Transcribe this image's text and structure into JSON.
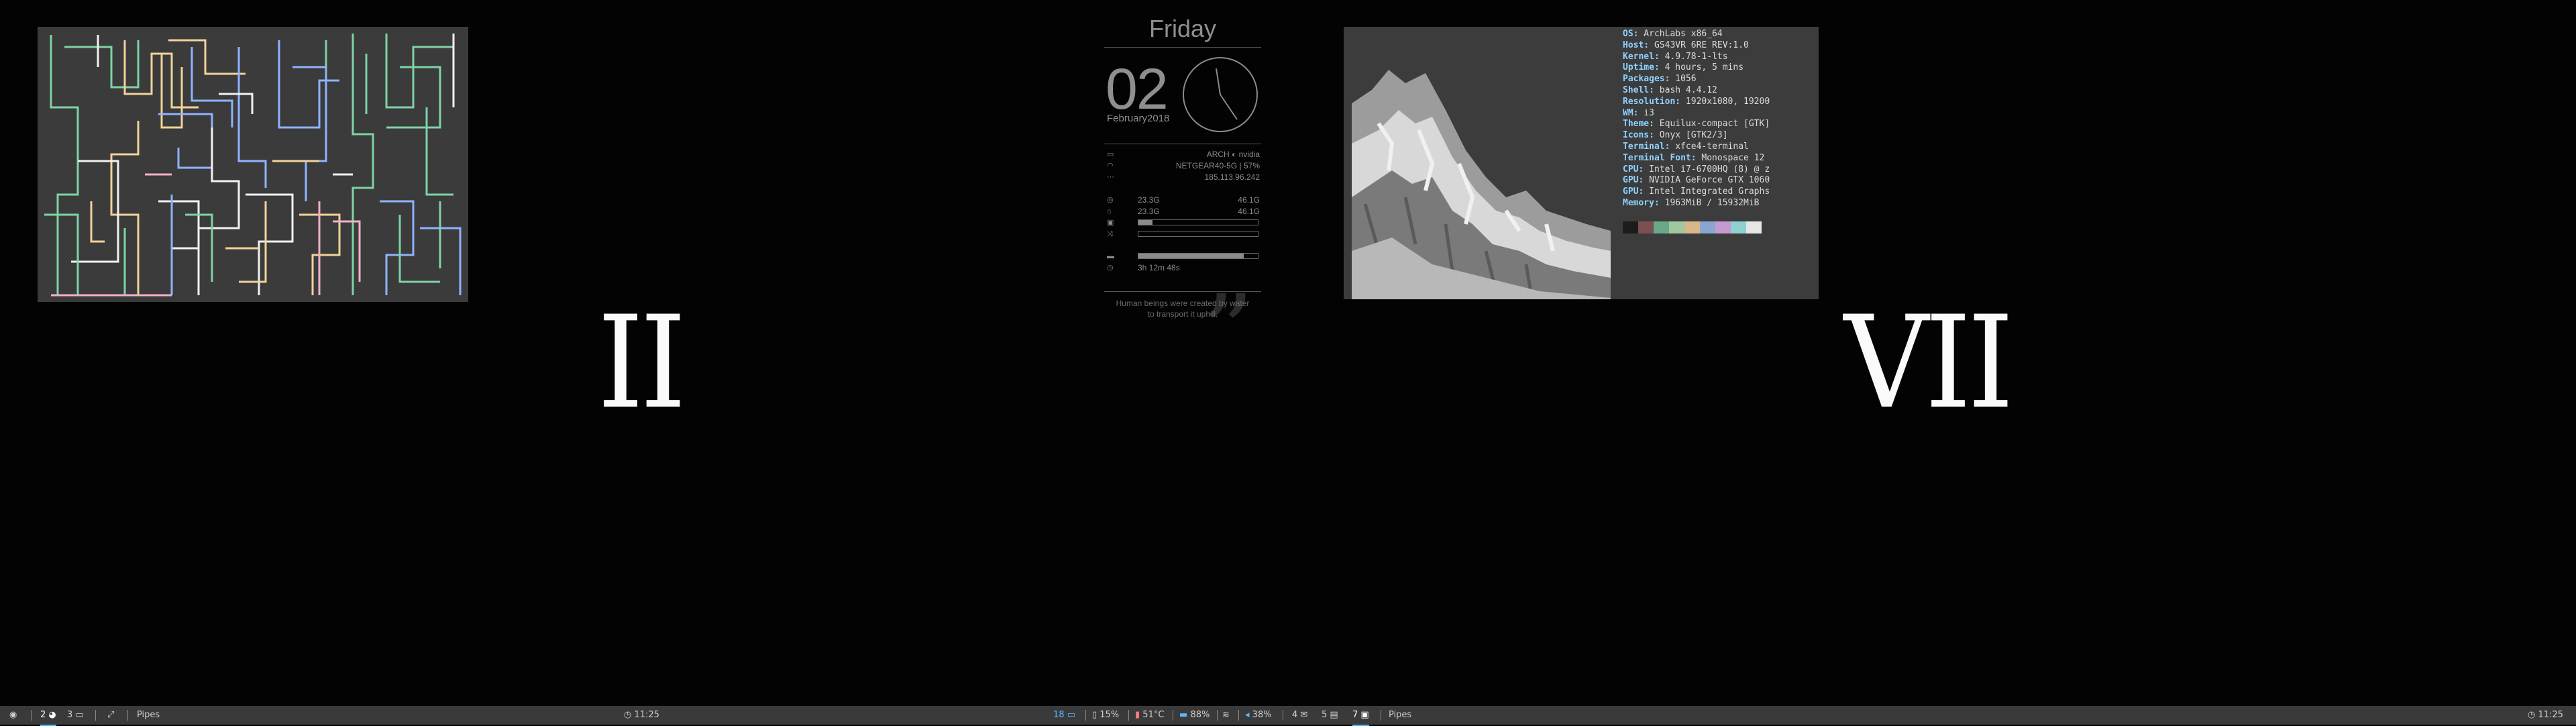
{
  "taskbar_left": {
    "workspaces": [
      {
        "label": "2",
        "icon": "globe-icon"
      },
      {
        "label": "3",
        "icon": "folder-icon"
      }
    ],
    "window_title": "Pipes",
    "clock": "11:25"
  },
  "taskbar_right": {
    "workspace_current": "18",
    "cpu": "15%",
    "temp": "51°C",
    "battery": "88%",
    "volume": "38%",
    "workspaces": [
      {
        "label": "4",
        "icon": "mail-icon"
      },
      {
        "label": "5",
        "icon": "document-icon"
      },
      {
        "label": "7",
        "icon": "terminal-icon"
      }
    ],
    "window_title": "Pipes",
    "clock": "11:25"
  },
  "workspaces": {
    "left_numeral": "II",
    "right_numeral": "VII"
  },
  "conky": {
    "day": "Friday",
    "date": "02",
    "month": "February2018",
    "distro": "ARCH",
    "gpu": "nvidia",
    "network": "NETGEAR40-5G | 57%",
    "ip": "185.113.96.242",
    "disk1_used": "23.3G",
    "disk1_total": "46.1G",
    "disk2_used": "23.3G",
    "disk2_total": "46.1G",
    "uptime": "3h 12m 48s",
    "quote": "Human beings were created by water\nto transport it uphill.",
    "bars": {
      "cpu": 0.12,
      "mem": 0.0,
      "battery": 0.88
    }
  },
  "neofetch": {
    "lines": [
      {
        "key": "OS",
        "value": " ArchLabs x86_64"
      },
      {
        "key": "Host",
        "value": " GS43VR 6RE REV:1.0"
      },
      {
        "key": "Kernel",
        "value": " 4.9.78-1-lts"
      },
      {
        "key": "Uptime",
        "value": " 4 hours, 5 mins"
      },
      {
        "key": "Packages",
        "value": " 1056"
      },
      {
        "key": "Shell",
        "value": " bash 4.4.12"
      },
      {
        "key": "Resolution",
        "value": " 1920x1080, 19200"
      },
      {
        "key": "WM",
        "value": " i3"
      },
      {
        "key": "Theme",
        "value": " Equilux-compact [GTK]"
      },
      {
        "key": "Icons",
        "value": " Onyx [GTK2/3]"
      },
      {
        "key": "Terminal",
        "value": " xfce4-terminal"
      },
      {
        "key": "Terminal Font",
        "value": " Monospace 12"
      },
      {
        "key": "CPU",
        "value": " Intel i7-6700HQ (8) @ z"
      },
      {
        "key": "GPU",
        "value": " NVIDIA GeForce GTX 1060"
      },
      {
        "key": "GPU",
        "value": " Intel Integrated Graphs"
      },
      {
        "key": "Memory",
        "value": " 1963MiB / 15932MiB"
      }
    ],
    "palette": [
      "#1c1c1c",
      "#7a5050",
      "#6aa88a",
      "#9fc7a0",
      "#d6b88a",
      "#8aa6d0",
      "#c59ad0",
      "#8fd0d0",
      "#e6e6e6"
    ]
  },
  "colors": {
    "accent": "#4fb0ff",
    "bar_bg": "#3a3a3a",
    "desktop": "#030303"
  }
}
